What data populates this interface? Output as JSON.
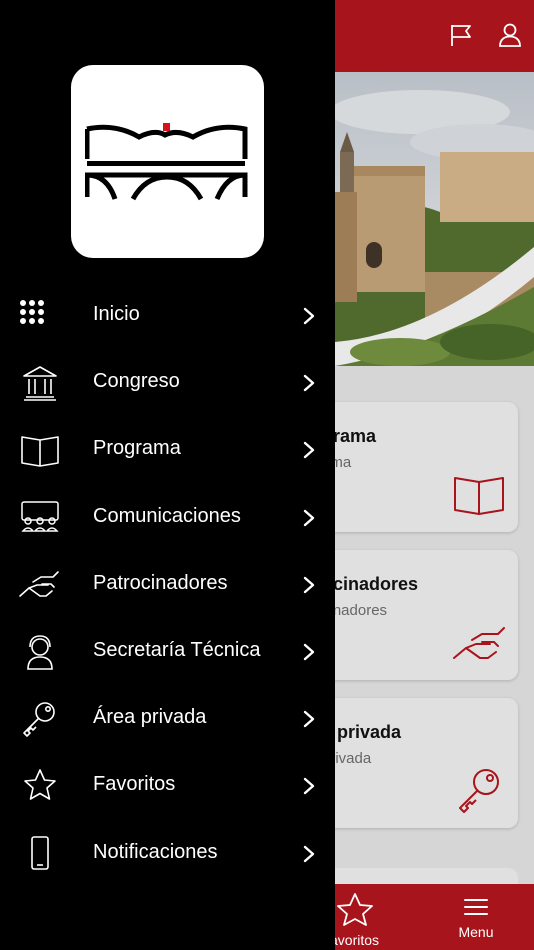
{
  "colors": {
    "brand_red": "#a8141c",
    "drawer_bg": "#000000",
    "text_white": "#ffffff"
  },
  "header": {
    "icons": [
      "flag-icon",
      "user-icon"
    ]
  },
  "cards": [
    {
      "title": "grama",
      "subtitle": "ama",
      "icon": "book-icon"
    },
    {
      "title": "ocinadores",
      "subtitle": "cinadores",
      "icon": "handshake-icon"
    },
    {
      "title": "a privada",
      "subtitle": "privada",
      "icon": "key-icon"
    }
  ],
  "bottom_nav": {
    "favorites_label": "avoritos",
    "menu_label": "Menu"
  },
  "menu": {
    "items": [
      {
        "label": "Inicio",
        "icon": "grid-icon"
      },
      {
        "label": "Congreso",
        "icon": "building-icon"
      },
      {
        "label": "Programa",
        "icon": "book-icon"
      },
      {
        "label": "Comunicaciones",
        "icon": "audience-icon"
      },
      {
        "label": "Patrocinadores",
        "icon": "handshake-icon"
      },
      {
        "label": "Secretaría Técnica",
        "icon": "support-icon"
      },
      {
        "label": "Área privada",
        "icon": "key-icon"
      },
      {
        "label": "Favoritos",
        "icon": "star-icon"
      },
      {
        "label": "Notificaciones",
        "icon": "phone-icon"
      }
    ]
  }
}
